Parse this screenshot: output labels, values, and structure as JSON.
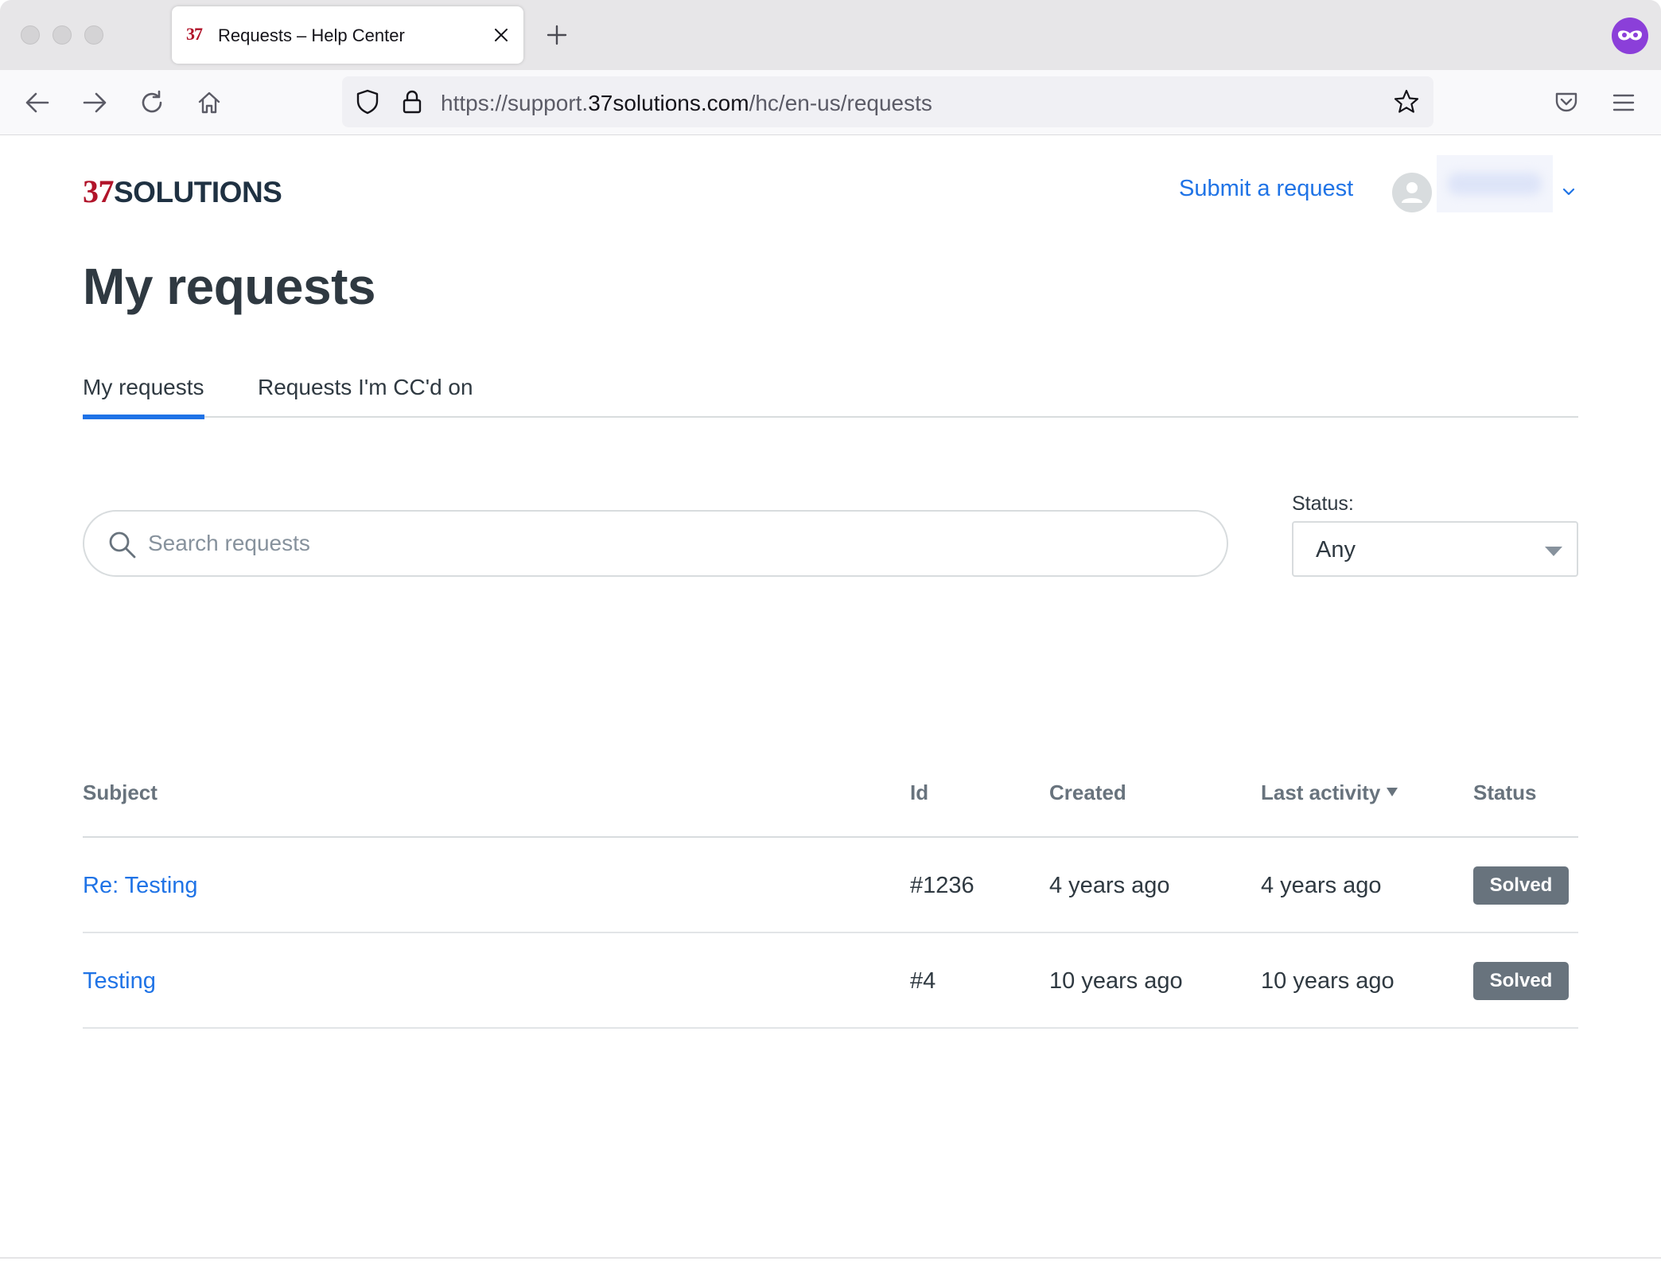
{
  "browser": {
    "tab": {
      "favicon_text": "37",
      "title": "Requests – Help Center"
    },
    "url": {
      "prefix": "https://support.",
      "host": "37solutions.com",
      "path": "/hc/en-us/requests"
    }
  },
  "header": {
    "logo": {
      "number": "37",
      "word": "SOLUTIONS"
    },
    "submit_request": "Submit a request"
  },
  "page_title": "My requests",
  "tabs": [
    {
      "label": "My requests",
      "active": true
    },
    {
      "label": "Requests I'm CC'd on",
      "active": false
    }
  ],
  "search": {
    "placeholder": "Search requests",
    "value": ""
  },
  "status_filter": {
    "label": "Status:",
    "selected": "Any"
  },
  "table": {
    "columns": {
      "subject": "Subject",
      "id": "Id",
      "created": "Created",
      "last_activity": "Last activity",
      "status": "Status"
    },
    "rows": [
      {
        "subject": "Re: Testing",
        "id": "#1236",
        "created": "4 years ago",
        "last_activity": "4 years ago",
        "status": "Solved"
      },
      {
        "subject": "Testing",
        "id": "#4",
        "created": "10 years ago",
        "last_activity": "10 years ago",
        "status": "Solved"
      }
    ]
  },
  "colors": {
    "accent": "#1f73e6",
    "brand_red": "#b1142a",
    "badge": "#68737d",
    "private_browsing": "#8b3fd9"
  }
}
